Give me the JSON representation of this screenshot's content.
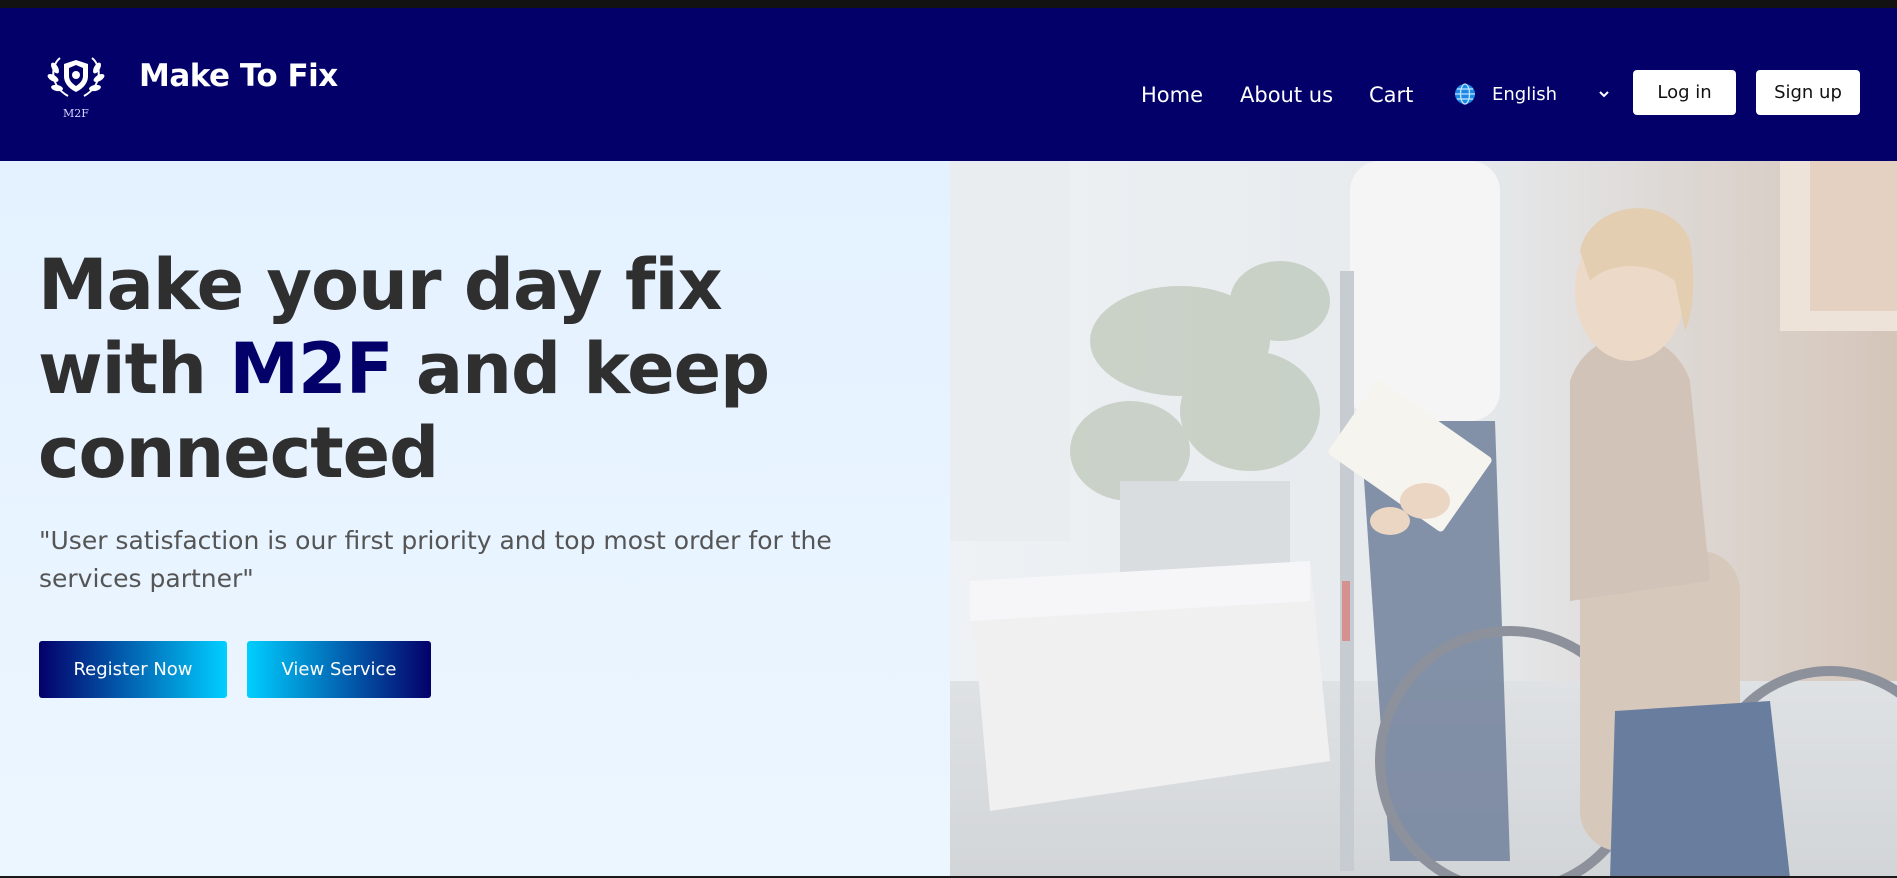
{
  "header": {
    "logo_caption": "M2F",
    "brand": "Make To Fix",
    "nav": [
      {
        "label": "Home"
      },
      {
        "label": "About us"
      },
      {
        "label": "Cart"
      }
    ],
    "language": {
      "selected": "English",
      "icon": "globe-icon"
    },
    "login_label": "Log in",
    "signup_label": "Sign up"
  },
  "hero": {
    "headline_part1": "Make your day fix with ",
    "headline_accent": "M2F",
    "headline_part2": " and keep connected",
    "quote": "\"User satisfaction is our first priority and top most order for the services partner\"",
    "register_label": "Register Now",
    "view_label": "View Service",
    "image_subject": "caregiver-with-woman-in-wheelchair-photo"
  },
  "colors": {
    "navbar_bg": "#03006a",
    "accent": "#04006a",
    "cyan": "#00cfff",
    "hero_bg": "#e5f1fd",
    "headline": "#2f2f2f",
    "quote": "#555555"
  }
}
